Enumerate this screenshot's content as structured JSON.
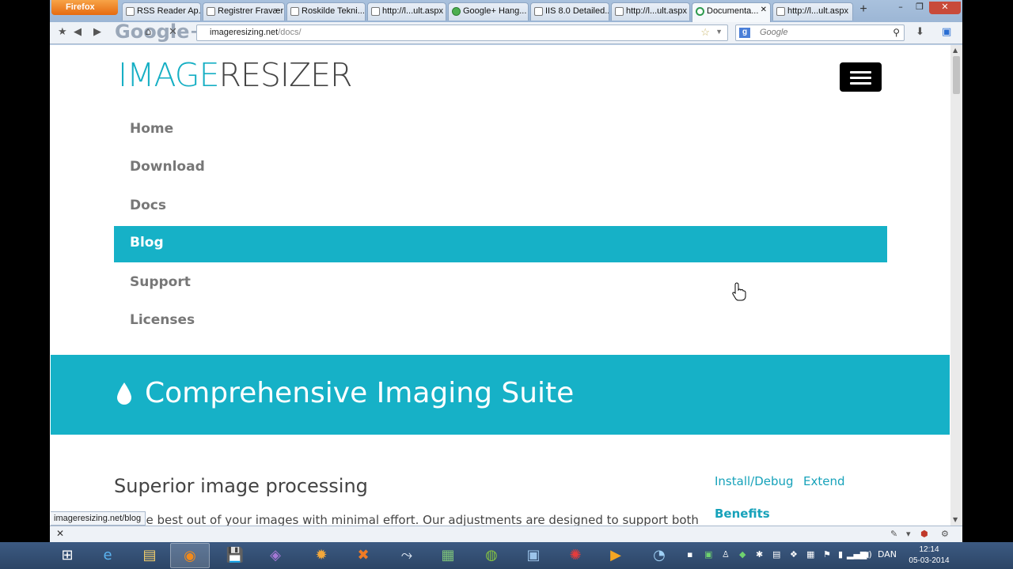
{
  "browser": {
    "menu_button": "Firefox",
    "tabs": [
      {
        "label": "RSS Reader Ap...",
        "favicon": "feed-icon"
      },
      {
        "label": "Registrer Fravær",
        "favicon": "form-icon"
      },
      {
        "label": "Roskilde Tekni...",
        "favicon": "arrow-icon"
      },
      {
        "label": "http://l...ult.aspx",
        "favicon": "page-icon"
      },
      {
        "label": "Google+ Hang...",
        "favicon": "hangouts-icon"
      },
      {
        "label": "IIS 8.0 Detailed...",
        "favicon": "page-icon"
      },
      {
        "label": "http://l...ult.aspx",
        "favicon": "page-icon"
      },
      {
        "label": "Documenta...",
        "favicon": "loading-icon",
        "active": true
      },
      {
        "label": "http://l...ult.aspx",
        "favicon": "page-icon"
      }
    ],
    "new_tab": "+",
    "window_controls": {
      "minimize": "–",
      "restore": "❐",
      "close": "✕"
    },
    "address": {
      "host": "imageresizing.net",
      "path": "/docs/"
    },
    "search": {
      "engine": "g",
      "placeholder": "Google"
    },
    "watermark": "Google+"
  },
  "page": {
    "logo": {
      "part1": "IMAGE",
      "part2": "RESIZER"
    },
    "menu_button_icon": "hamburger-icon",
    "menu": [
      {
        "label": "Home",
        "active": false
      },
      {
        "label": "Download",
        "active": false
      },
      {
        "label": "Docs",
        "active": false
      },
      {
        "label": "Blog",
        "active": true
      },
      {
        "label": "Support",
        "active": false
      },
      {
        "label": "Licenses",
        "active": false
      }
    ],
    "banner": {
      "icon": "water-drop-icon",
      "title": "Comprehensive Imaging Suite"
    },
    "section": {
      "title": "Superior image processing",
      "body": "he best out of your images with minimal effort. Our adjustments are designed to support both"
    },
    "sidebar": {
      "links": [
        "Install/Debug",
        "Extend"
      ],
      "heading": "Benefits"
    },
    "status_url": "imageresizing.net/blog"
  },
  "taskbar": {
    "apps": [
      {
        "name": "start-button",
        "icon": "⊞"
      },
      {
        "name": "internet-explorer",
        "icon": "e"
      },
      {
        "name": "file-explorer",
        "icon": "▤"
      },
      {
        "name": "firefox",
        "icon": "◉"
      },
      {
        "name": "save-app",
        "icon": "💾"
      },
      {
        "name": "visual-studio",
        "icon": "◈"
      },
      {
        "name": "settings-app",
        "icon": "✹"
      },
      {
        "name": "xampp",
        "icon": "✖"
      },
      {
        "name": "sql-tool",
        "icon": "⤳"
      },
      {
        "name": "excel-app",
        "icon": "▦"
      },
      {
        "name": "spotify",
        "icon": "◍"
      },
      {
        "name": "remote-app",
        "icon": "▣"
      },
      {
        "name": "splash-app",
        "icon": "✺"
      },
      {
        "name": "media-player",
        "icon": "▶"
      },
      {
        "name": "chat-app",
        "icon": "◔"
      }
    ],
    "language": "DAN",
    "time": "12:14",
    "date": "05-03-2014"
  },
  "colors": {
    "accent": "#16b1c7",
    "taskbar": "#34506f",
    "link": "#16a2ba"
  }
}
